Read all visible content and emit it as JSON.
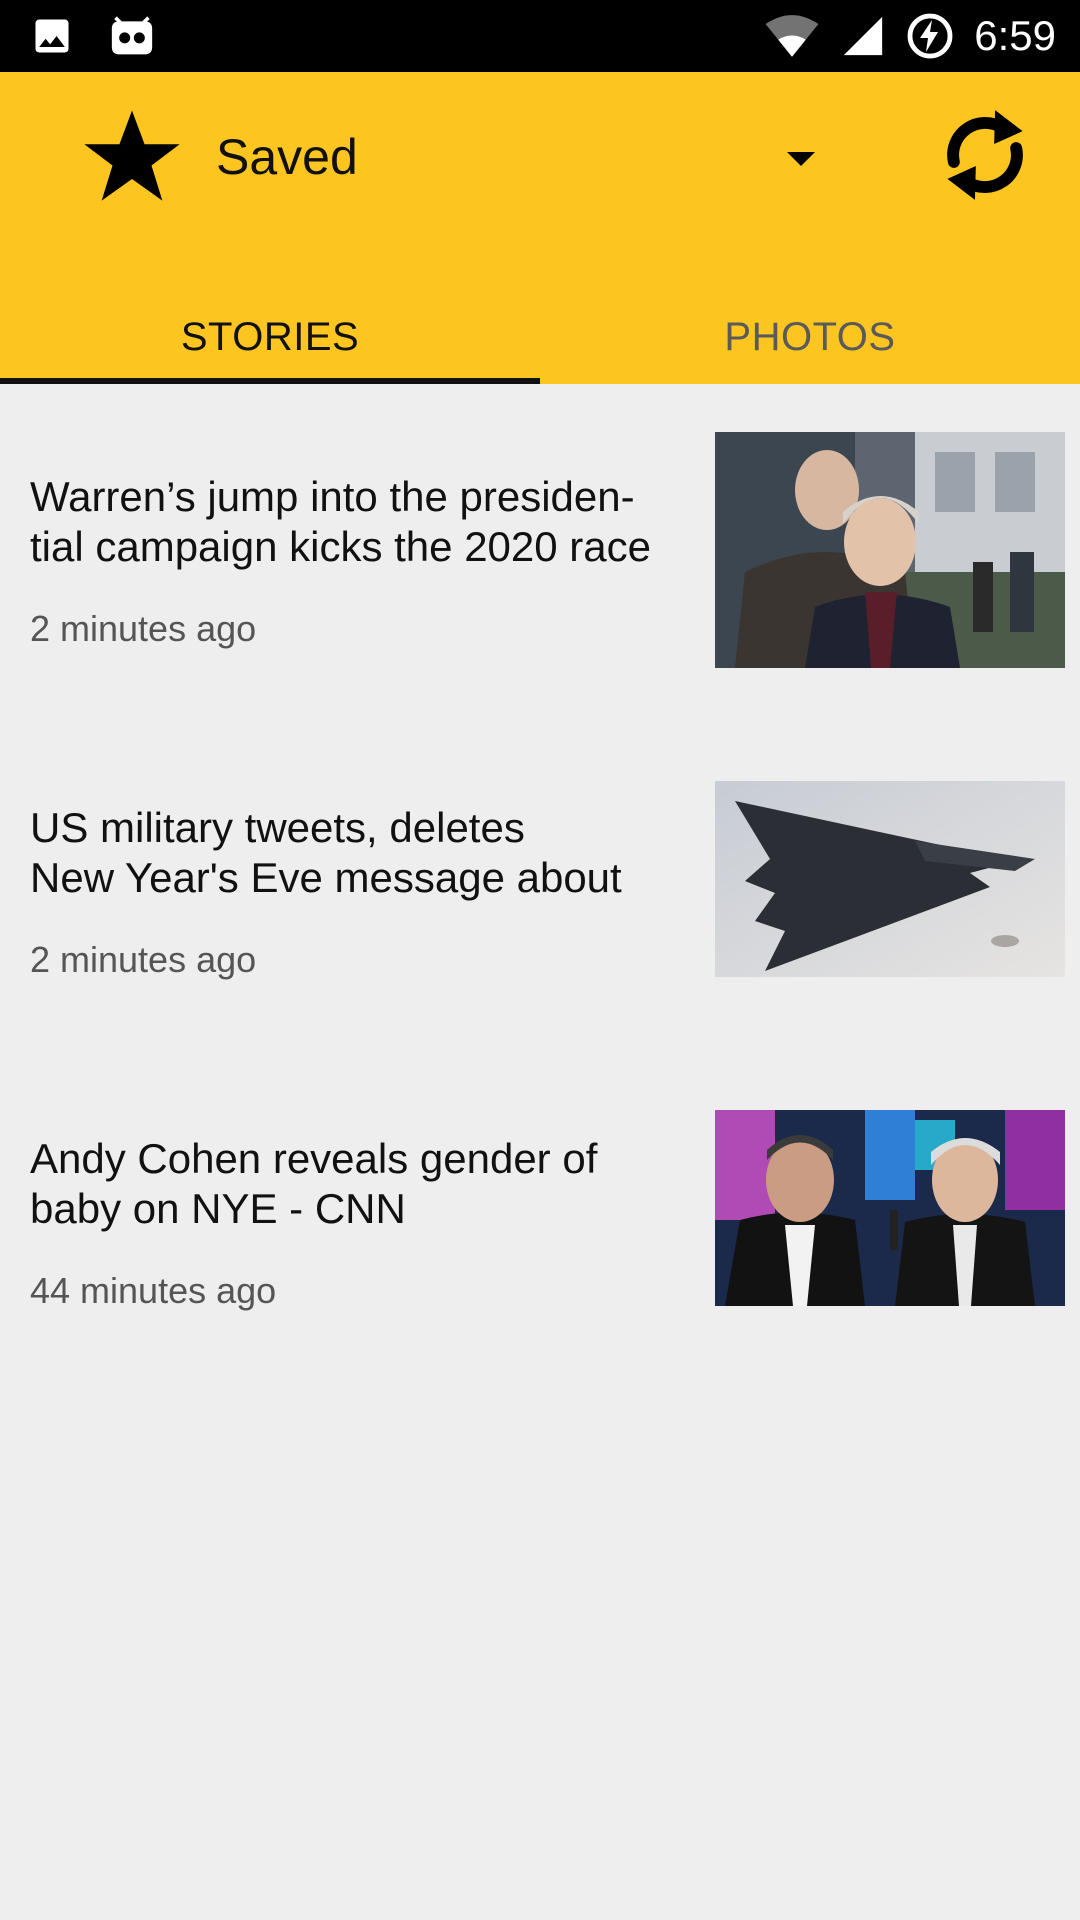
{
  "status_bar": {
    "time": "6:59",
    "icons": [
      "image-icon",
      "robot-icon",
      "wifi-icon",
      "signal-icon",
      "battery-charging-icon"
    ]
  },
  "header": {
    "title": "Saved",
    "icon": "star-icon",
    "accent_color": "#fdc51f"
  },
  "tabs": [
    {
      "label": "STORIES",
      "selected": true
    },
    {
      "label": "PHOTOS",
      "selected": false
    }
  ],
  "stories": [
    {
      "headline": "Warren’s jump into the presiden-tial campaign kicks the 2020 race",
      "headline_lines": [
        "Warren’s jump into the presiden-",
        "tial campaign kicks the 2020 race"
      ],
      "time": "2 minutes ago"
    },
    {
      "headline": "US military tweets, deletes New Year's Eve message about",
      "headline_lines": [
        "US military tweets, deletes",
        "New Year's Eve message about"
      ],
      "time": "2 minutes ago"
    },
    {
      "headline": "Andy Cohen reveals gender of baby on NYE - CNN",
      "headline_lines": [
        "Andy Cohen reveals gender of",
        "baby on NYE - CNN"
      ],
      "time": "44 minutes ago"
    }
  ]
}
